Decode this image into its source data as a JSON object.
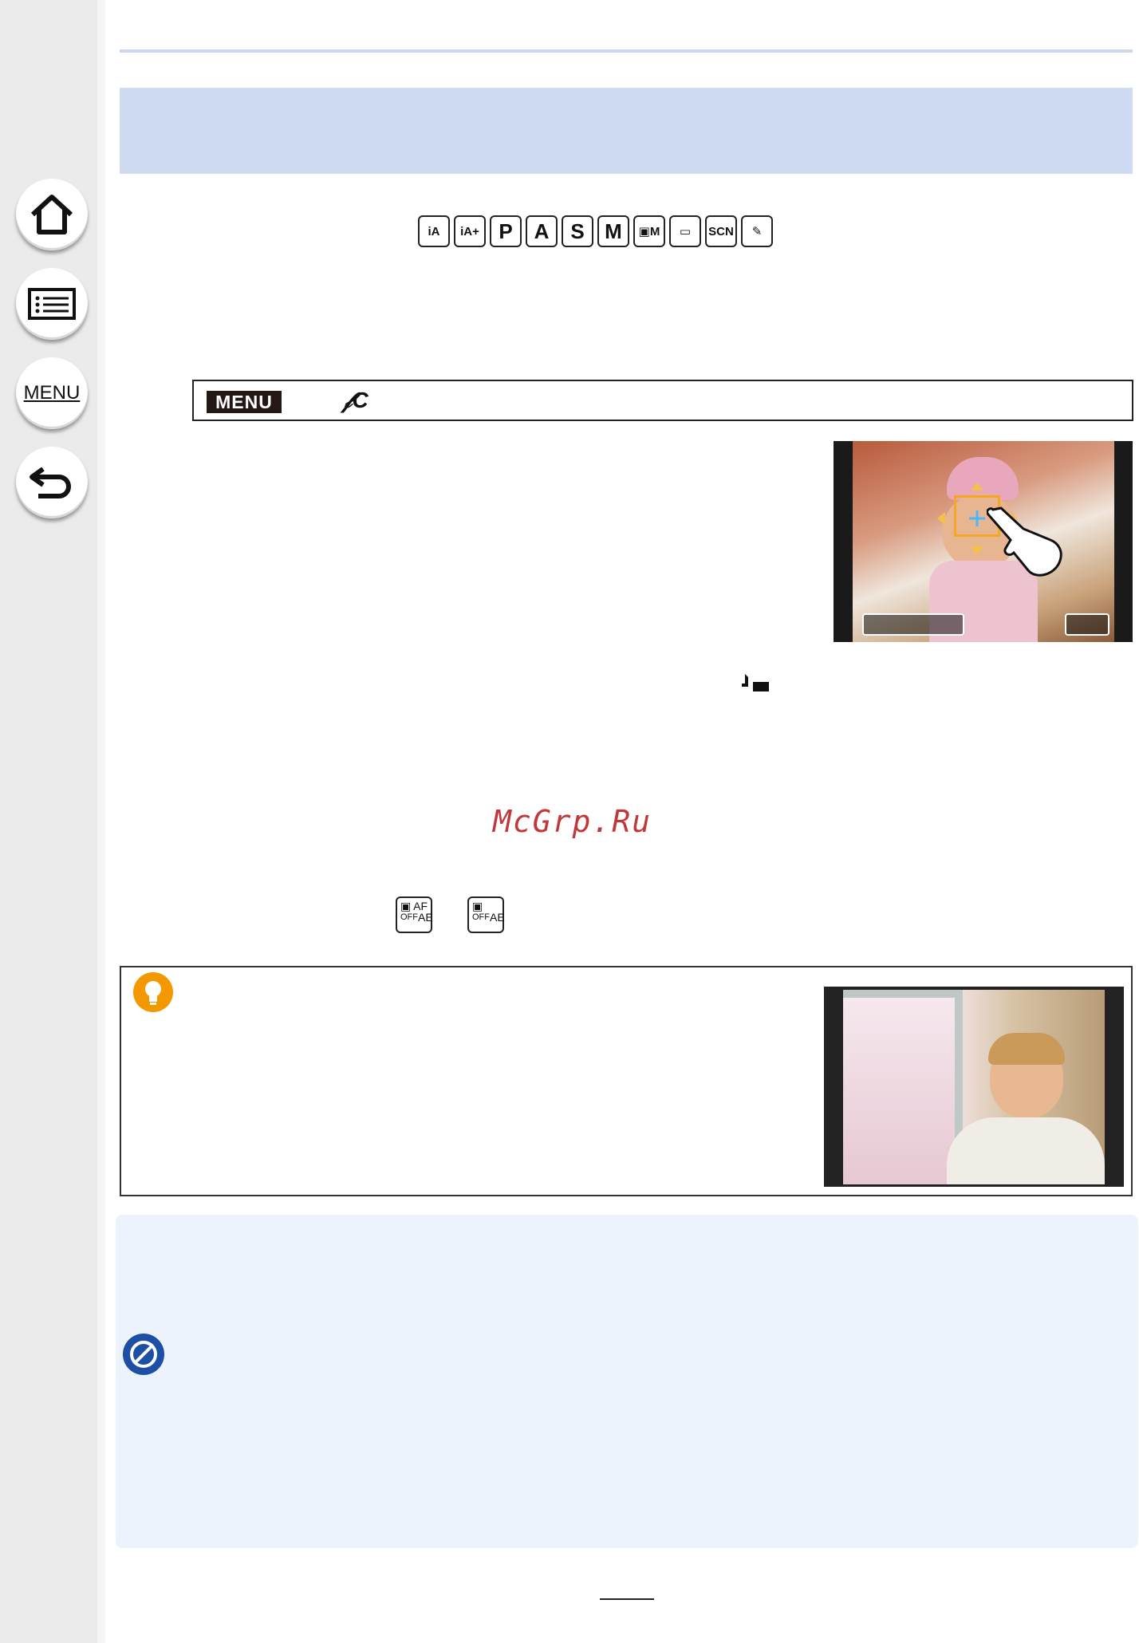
{
  "sidebar": {
    "buttons": [
      {
        "name": "home-icon"
      },
      {
        "name": "list-icon"
      },
      {
        "name": "menu-button",
        "label": "MENU"
      },
      {
        "name": "back-icon"
      }
    ]
  },
  "modes": {
    "icons": [
      "iA",
      "iA+",
      "P",
      "A",
      "S",
      "M",
      "▣M",
      "▭",
      "SCN",
      "✎"
    ]
  },
  "menu_path": {
    "tag": "MENU",
    "icon": "𝒻C"
  },
  "watermark": "McGrp.Ru",
  "af_icons": [
    {
      "top": "AF",
      "bottom": "AE",
      "prefix": "OFF"
    },
    {
      "top": "",
      "bottom": "AE",
      "prefix": "OFF"
    }
  ],
  "colors": {
    "banner": "#cedbf3",
    "tip_icon": "#f39800",
    "note_icon": "#1d4fa5",
    "note_bg": "#edf3fd",
    "focus_frame": "#f5a623"
  }
}
